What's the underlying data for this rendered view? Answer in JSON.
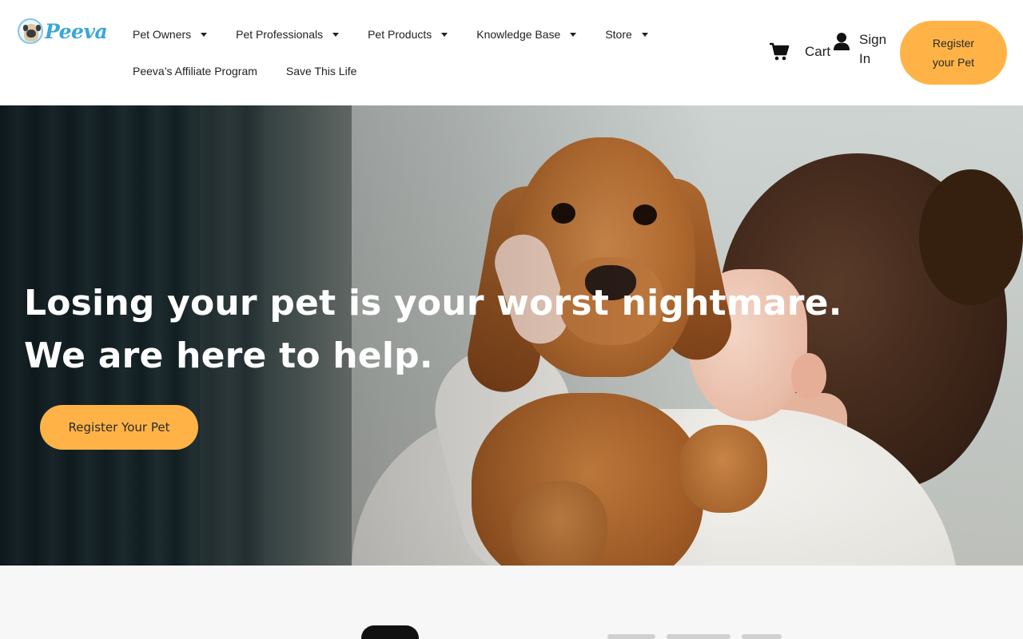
{
  "brand": {
    "name": "Peeva",
    "color": "#3aa7d6"
  },
  "nav": {
    "items": [
      {
        "label": "Pet Owners",
        "has_dropdown": true
      },
      {
        "label": "Pet Professionals",
        "has_dropdown": true
      },
      {
        "label": "Pet Products",
        "has_dropdown": true
      },
      {
        "label": "Knowledge Base",
        "has_dropdown": true
      },
      {
        "label": "Store",
        "has_dropdown": true
      },
      {
        "label": "Peeva’s Affiliate Program",
        "has_dropdown": false
      },
      {
        "label": "Save This Life",
        "has_dropdown": false
      }
    ]
  },
  "header_actions": {
    "cart_label": "Cart",
    "cart_icon": "shopping-cart-icon",
    "signin_label": "Sign In",
    "signin_icon": "user-icon",
    "register_label": "Register your Pet"
  },
  "hero": {
    "title_line1": "Losing your pet is your worst nightmare.",
    "title_line2": "We are here to help.",
    "cta_label": "Register Your Pet"
  },
  "colors": {
    "accent": "#ffb347",
    "text": "#222222",
    "hero_text": "#ffffff",
    "section_bg": "#f7f7f7"
  }
}
